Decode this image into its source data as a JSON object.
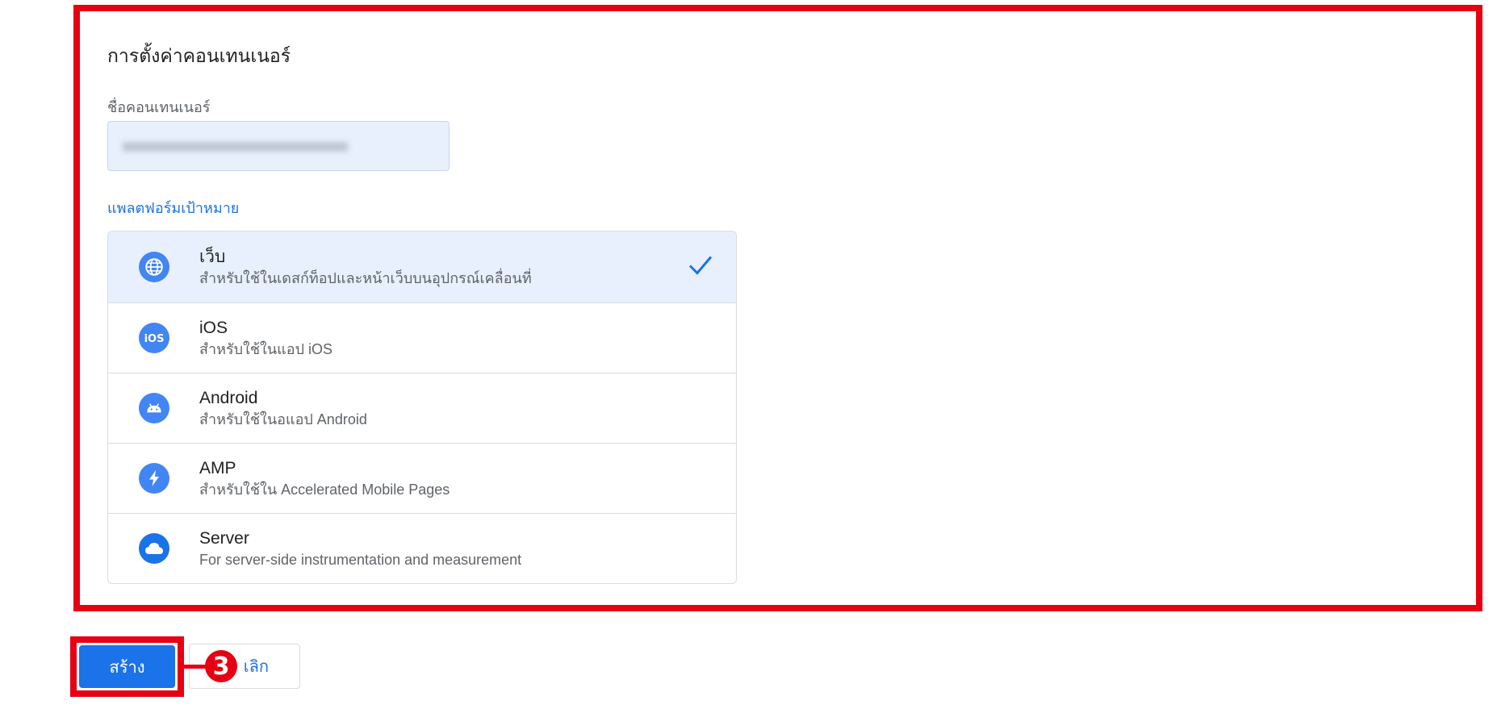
{
  "container_settings": {
    "title": "การตั้งค่าคอนเทนเนอร์",
    "name_label": "ชื่อคอนเทนเนอร์",
    "name_value": "xxxxxxxxxxxxxxxxxxxxxxxxxxxxxxx",
    "platform_label": "แพลตฟอร์มเป้าหมาย"
  },
  "platforms": [
    {
      "icon": "globe-icon",
      "title": "เว็บ",
      "description": "สำหรับใช้ในเดสก์ท็อปและหน้าเว็บบนอุปกรณ์เคลื่อนที่",
      "selected": true
    },
    {
      "icon": "ios-icon",
      "title": "iOS",
      "description": "สำหรับใช้ในแอป iOS",
      "selected": false
    },
    {
      "icon": "android-icon",
      "title": "Android",
      "description": "สำหรับใช้ในอแอป Android",
      "selected": false
    },
    {
      "icon": "amp-lightning-icon",
      "title": "AMP",
      "description": "สำหรับใช้ใน Accelerated Mobile Pages",
      "selected": false
    },
    {
      "icon": "cloud-icon",
      "title": "Server",
      "description": "For server-side instrumentation and measurement",
      "selected": false
    }
  ],
  "actions": {
    "create_label": "สร้าง",
    "cancel_label": "เลิก"
  },
  "annotation": {
    "step_number": "3",
    "color": "#e60012"
  },
  "colors": {
    "accent": "#1a73e8",
    "selected_bg": "#e8f0fe",
    "icon_bg": "#4285f4"
  }
}
